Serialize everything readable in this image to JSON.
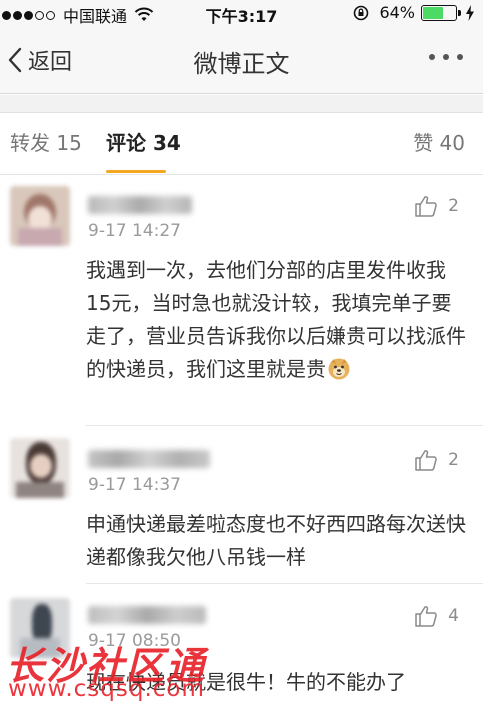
{
  "status_bar": {
    "carrier": "中国联通",
    "time": "下午3:17",
    "battery_pct": "64%",
    "battery_level": 0.64,
    "signal_dots_filled": 3,
    "signal_dots_total": 5
  },
  "nav": {
    "back_label": "返回",
    "title": "微博正文"
  },
  "tabs": [
    {
      "label": "转发 15"
    },
    {
      "label": "评论 34"
    },
    {
      "label": "赞 40"
    }
  ],
  "comments": [
    {
      "time": "9-17 14:27",
      "likes": "2",
      "text": "我遇到一次，去他们分部的店里发件收我15元，当时急也就没计较，我填完单子要走了，营业员告诉我你以后嫌贵可以找派件的快递员，我们这里就是贵",
      "emoji": "doge-emoji"
    },
    {
      "time": "9-17 14:37",
      "likes": "2",
      "text": "申通快递最差啦态度也不好西四路每次送快递都像我欠他八吊钱一样"
    },
    {
      "time": "9-17 08:50",
      "likes": "4",
      "text": "现在快递员就是很牛！牛的不能办了"
    }
  ],
  "watermark": {
    "main": "长沙社区通",
    "url": "www.csqsq.com"
  },
  "colors": {
    "accent": "#f5a623",
    "watermark": "#e8232b",
    "battery": "#4cd964"
  }
}
